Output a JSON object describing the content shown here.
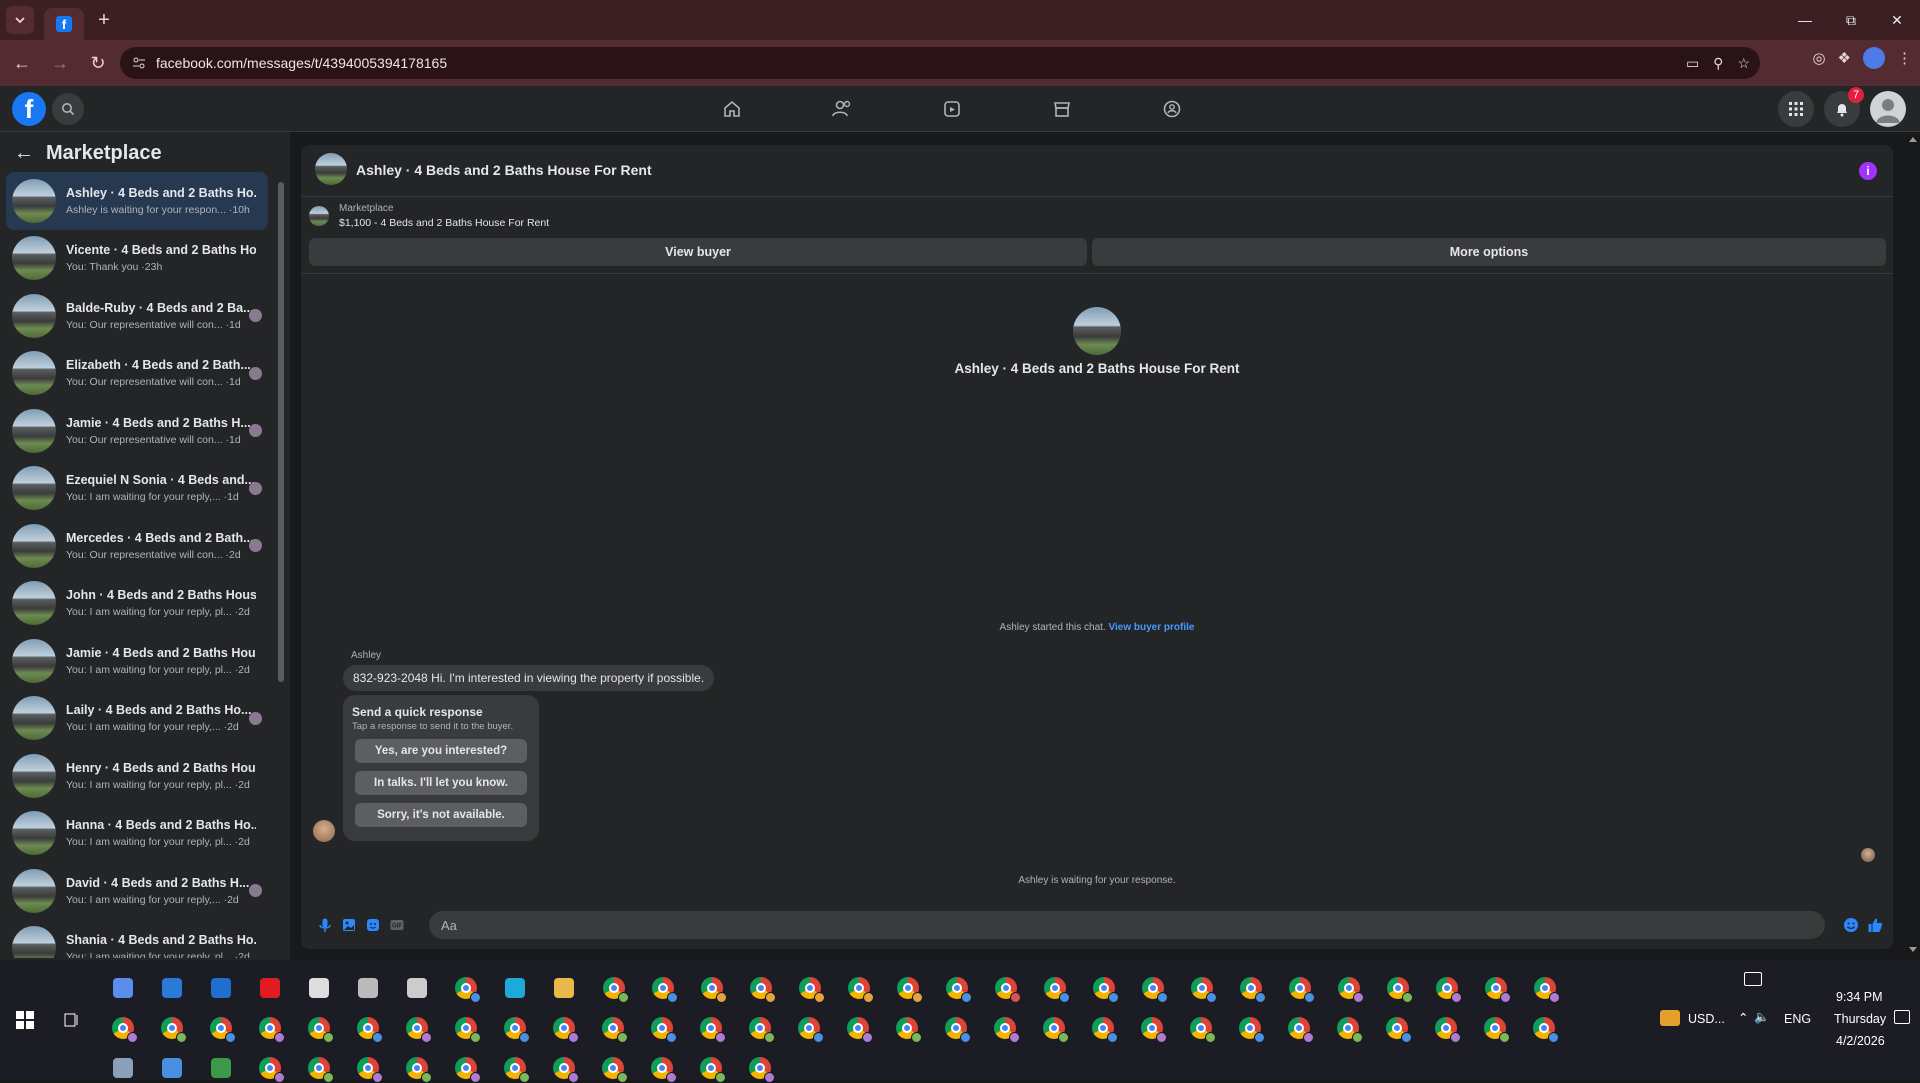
{
  "browser": {
    "url": "facebook.com/messages/t/4394005394178165"
  },
  "header": {
    "notifications_count": "7"
  },
  "sidebar": {
    "title": "Marketplace",
    "conversations": [
      {
        "name": "Ashley · 4 Beds and 2 Baths Ho...",
        "preview": "Ashley is waiting for your respon... ·10h",
        "active": true
      },
      {
        "name": "Vicente · 4 Beds and 2 Baths Ho...",
        "preview": "You: Thank you ·23h"
      },
      {
        "name": "Balde-Ruby · 4 Beds and 2 Ba...",
        "preview": "You: Our representative will con... ·1d"
      },
      {
        "name": "Elizabeth · 4 Beds and 2 Bath...",
        "preview": "You: Our representative will con... ·1d"
      },
      {
        "name": "Jamie · 4 Beds and 2 Baths H...",
        "preview": "You: Our representative will con... ·1d"
      },
      {
        "name": "Ezequiel N Sonia · 4 Beds and...",
        "preview": "You: I am waiting for your reply,... ·1d"
      },
      {
        "name": "Mercedes · 4 Beds and 2 Bath...",
        "preview": "You: Our representative will con... ·2d"
      },
      {
        "name": "John · 4 Beds and 2 Baths Hous...",
        "preview": "You: I am waiting for your reply, pl... ·2d"
      },
      {
        "name": "Jamie · 4 Beds and 2 Baths Hou...",
        "preview": "You: I am waiting for your reply, pl... ·2d"
      },
      {
        "name": "Laily · 4 Beds and 2 Baths Ho...",
        "preview": "You: I am waiting for your reply,... ·2d"
      },
      {
        "name": "Henry · 4 Beds and 2 Baths Hou...",
        "preview": "You: I am waiting for your reply, pl... ·2d"
      },
      {
        "name": "Hanna · 4 Beds and 2 Baths Ho...",
        "preview": "You: I am waiting for your reply, pl... ·2d"
      },
      {
        "name": "David · 4 Beds and 2 Baths H...",
        "preview": "You: I am waiting for your reply,... ·2d"
      },
      {
        "name": "Shania · 4 Beds and 2 Baths Ho...",
        "preview": "You: I am waiting for your reply, pl... ·2d"
      }
    ]
  },
  "chat": {
    "title": "Ashley · 4 Beds and 2 Baths House For Rent",
    "listing_source": "Marketplace",
    "listing_desc": "$1,100 - 4 Beds and 2 Baths House For Rent",
    "view_buyer": "View buyer",
    "more_options": "More options",
    "hero_title": "Ashley · 4 Beds and 2 Baths House For Rent",
    "started_text": "Ashley started this chat.",
    "started_link": "View buyer profile",
    "sender": "Ashley",
    "message": "832-923-2048 Hi. I'm interested in viewing the property if possible.",
    "quick_title": "Send a quick response",
    "quick_sub": "Tap a response to send it to the buyer.",
    "quick_replies": [
      "Yes, are you interested?",
      "In talks. I'll let you know.",
      "Sorry, it's not available."
    ],
    "waiting": "Ashley is waiting for your response.",
    "input_placeholder": "Aa"
  },
  "tray": {
    "currency": "USD...",
    "lang": "ENG",
    "time": "9:34 PM",
    "day": "Thursday",
    "date": "4/2/2026"
  }
}
